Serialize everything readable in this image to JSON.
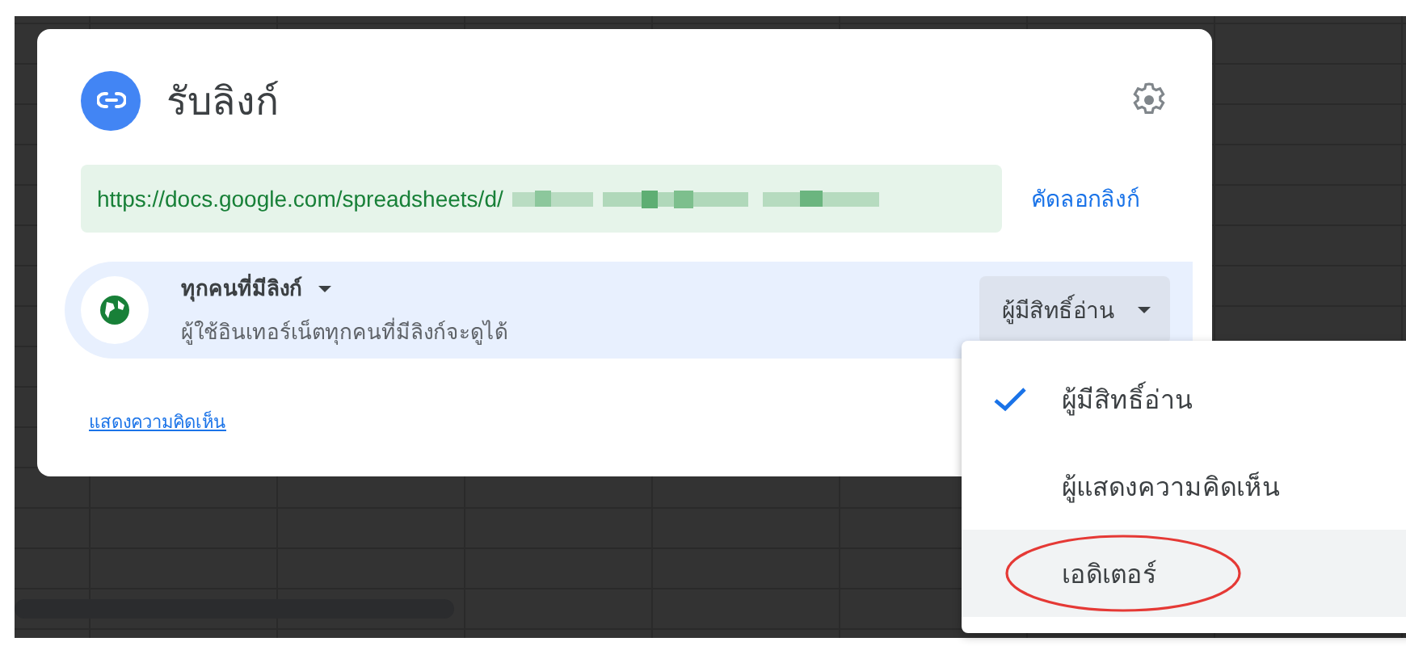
{
  "dialog": {
    "title": "รับลิงก์",
    "url": "https://docs.google.com/spreadsheets/d/",
    "url_redacted": true,
    "copy_link": "คัดลอกลิงก์",
    "access": {
      "title": "ทุกคนที่มีลิงก์",
      "description": "ผู้ใช้อินเทอร์เน็ตทุกคนที่มีลิงก์จะดูได้",
      "role": "ผู้มีสิทธิ์อ่าน"
    },
    "comment_link": "แสดงความคิดเห็น"
  },
  "role_menu": {
    "items": [
      {
        "label": "ผู้มีสิทธิ์อ่าน",
        "selected": true,
        "hovered": false,
        "circled": false
      },
      {
        "label": "ผู้แสดงความคิดเห็น",
        "selected": false,
        "hovered": false,
        "circled": false
      },
      {
        "label": "เอดิเตอร์",
        "selected": false,
        "hovered": true,
        "circled": true
      }
    ]
  }
}
